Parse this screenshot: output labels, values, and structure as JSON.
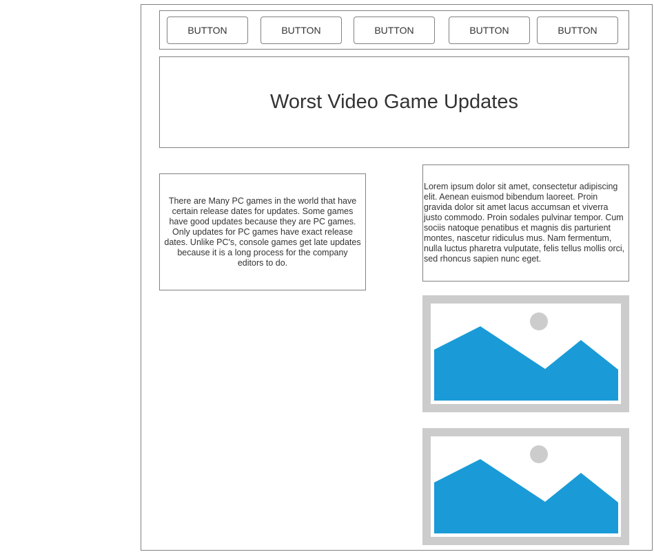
{
  "nav": {
    "buttons": [
      "BUTTON",
      "BUTTON",
      "BUTTON",
      "BUTTON",
      "BUTTON"
    ]
  },
  "header": {
    "title": "Worst Video Game Updates"
  },
  "content": {
    "left_text": "There are Many PC games in the world that have certain release dates for updates. Some games have good updates because they are PC games. Only updates for PC games have exact release dates. Unlike PC's, console games get late updates because it is a long process for the company editors to do.",
    "right_text": "Lorem ipsum dolor sit amet, consectetur adipiscing elit. Aenean euismod bibendum laoreet. Proin gravida dolor sit amet lacus accumsan et viverra justo commodo. Proin sodales pulvinar tempor. Cum sociis natoque penatibus et magnis dis parturient montes, nascetur ridiculus mus. Nam fermentum, nulla luctus pharetra vulputate, felis tellus mollis orci, sed rhoncus sapien nunc eget."
  },
  "images": [
    {
      "icon": "image-placeholder-icon"
    },
    {
      "icon": "image-placeholder-icon"
    }
  ],
  "colors": {
    "border": "#808080",
    "image_frame": "#cccccc",
    "image_mountain": "#1a9bd7",
    "image_sun": "#cccccc",
    "text": "#333333"
  }
}
